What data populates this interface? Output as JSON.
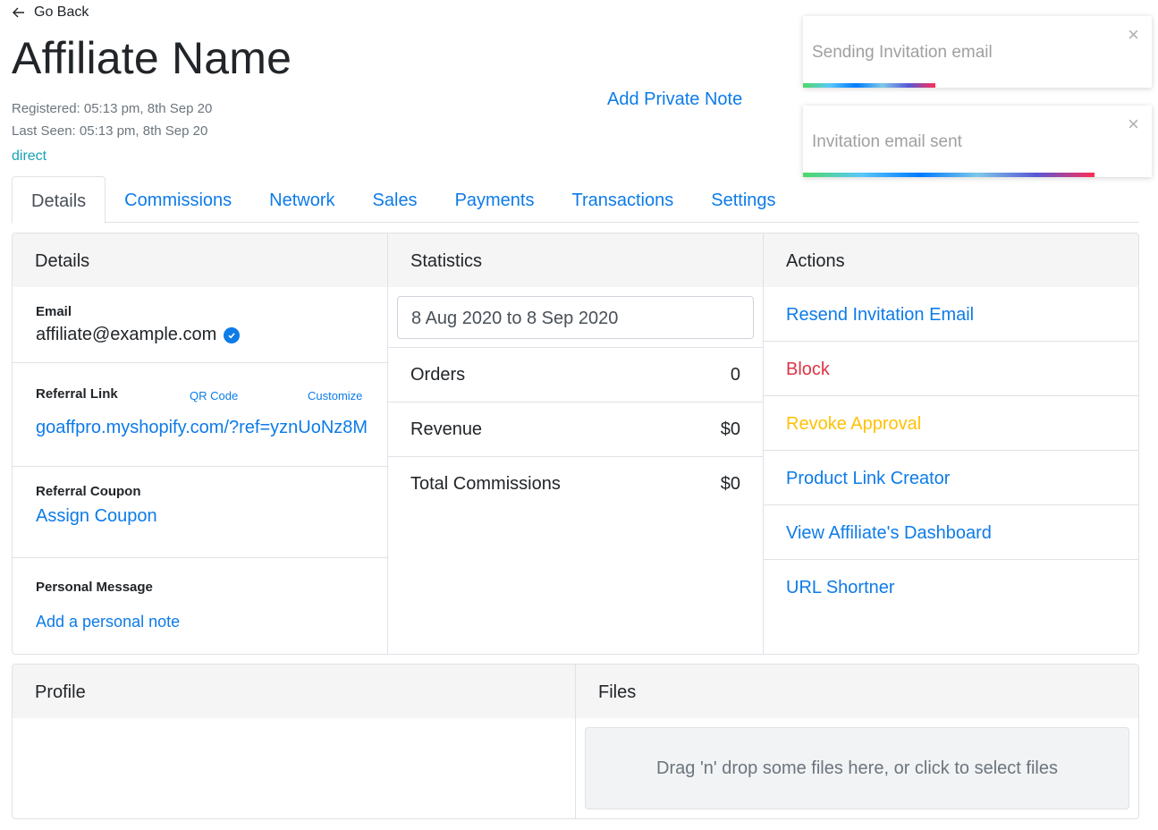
{
  "header": {
    "go_back": "Go Back",
    "title": "Affiliate Name",
    "registered": "Registered: 05:13 pm, 8th Sep 20",
    "last_seen": "Last Seen: 05:13 pm, 8th Sep 20",
    "source": "direct",
    "add_private_note": "Add Private Note"
  },
  "tabs": [
    {
      "label": "Details",
      "active": true
    },
    {
      "label": "Commissions"
    },
    {
      "label": "Network"
    },
    {
      "label": "Sales"
    },
    {
      "label": "Payments"
    },
    {
      "label": "Transactions"
    },
    {
      "label": "Settings"
    }
  ],
  "details": {
    "heading": "Details",
    "email_label": "Email",
    "email_value": "affiliate@example.com",
    "referral_label": "Referral Link",
    "qr_code": "QR Code",
    "customize": "Customize",
    "referral_link": "goaffpro.myshopify.com/?ref=yznUoNz8M",
    "coupon_label": "Referral Coupon",
    "assign_coupon": "Assign Coupon",
    "message_label": "Personal Message",
    "add_note": "Add a personal note"
  },
  "statistics": {
    "heading": "Statistics",
    "date_range": "8 Aug 2020 to 8 Sep 2020",
    "rows": [
      {
        "label": "Orders",
        "value": "0"
      },
      {
        "label": "Revenue",
        "value": "$0"
      },
      {
        "label": "Total Commissions",
        "value": "$0"
      }
    ]
  },
  "actions": {
    "heading": "Actions",
    "items": [
      {
        "label": "Resend Invitation Email",
        "color": "#0d7be8"
      },
      {
        "label": "Block",
        "color": "#dc3545"
      },
      {
        "label": "Revoke Approval",
        "color": "#ffc107"
      },
      {
        "label": "Product Link Creator",
        "color": "#0d7be8"
      },
      {
        "label": "View Affiliate's Dashboard",
        "color": "#0d7be8"
      },
      {
        "label": "URL Shortner",
        "color": "#0d7be8"
      }
    ]
  },
  "profile": {
    "heading": "Profile"
  },
  "files": {
    "heading": "Files",
    "dropzone": "Drag 'n' drop some files here, or click to select files"
  },
  "toasts": [
    {
      "message": "Sending Invitation email",
      "close": "×",
      "progress": 0.38
    },
    {
      "message": "Invitation email sent",
      "close": "×",
      "progress": 0.835
    }
  ]
}
